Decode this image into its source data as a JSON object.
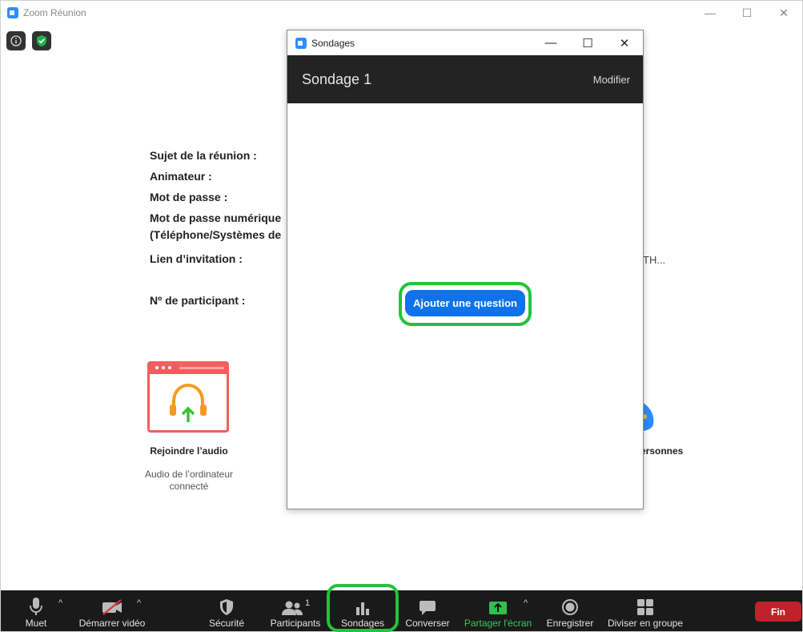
{
  "window": {
    "title": "Zoom Réunion",
    "minimize": "—",
    "maximize": "☐",
    "close": "✕"
  },
  "meeting_info": {
    "topic_label": "Sujet de la réunion :",
    "host_label": "Animateur :",
    "password_label": "Mot de passe :",
    "numeric_password_label_line1": "Mot de passe numérique",
    "numeric_password_label_line2": "(Téléphone/Systèmes de",
    "invite_link_label": "Lien d’invitation :",
    "invite_link_value_tail": "TH...",
    "participant_id_label": "Nº de participant :"
  },
  "audio": {
    "label": "Rejoindre l’audio",
    "sub_line1": "Audio de l’ordinateur",
    "sub_line2": "connecté"
  },
  "invite": {
    "label_tail": "ersonnes"
  },
  "poll_dialog": {
    "title": "Sondages",
    "poll_name": "Sondage 1",
    "edit_label": "Modifier",
    "add_question_label": "Ajouter une question"
  },
  "toolbar": {
    "mute": "Muet",
    "start_video": "Démarrer vidéo",
    "security": "Sécurité",
    "participants": "Participants",
    "participants_count": "1",
    "polls": "Sondages",
    "chat": "Converser",
    "share_screen": "Partager l'écran",
    "record": "Enregistrer",
    "breakout": "Diviser en groupe",
    "end": "Fin"
  },
  "colors": {
    "zoom_blue": "#2d8cff",
    "button_blue": "#0e72ed",
    "highlight_green": "#22c43a",
    "share_green": "#3ec55b",
    "end_red": "#c0212a",
    "toolbar_bg": "#1a1a1a"
  }
}
